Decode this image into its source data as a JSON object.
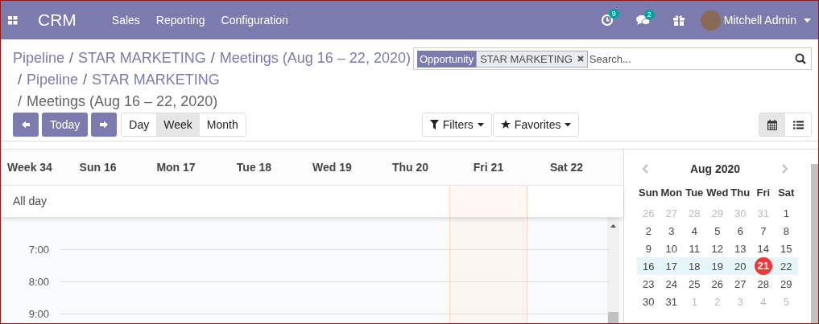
{
  "navbar": {
    "brand": "CRM",
    "menu": [
      "Sales",
      "Reporting",
      "Configuration"
    ],
    "activity_count": "9",
    "message_count": "2",
    "user": "Mitchell Admin"
  },
  "breadcrumbs": [
    [
      {
        "label": "Pipeline",
        "kind": "link"
      },
      {
        "label": "/",
        "kind": "separator"
      },
      {
        "label": "STAR MARKETING",
        "kind": "link"
      },
      {
        "label": "/",
        "kind": "separator"
      },
      {
        "label": "Meetings (Aug 16 – 22, 2020)",
        "kind": "link"
      }
    ],
    [
      {
        "label": "/",
        "kind": "separator"
      },
      {
        "label": "Pipeline",
        "kind": "link"
      },
      {
        "label": "/",
        "kind": "separator"
      },
      {
        "label": "STAR MARKETING",
        "kind": "link"
      }
    ],
    [
      {
        "label": "/",
        "kind": "separator"
      },
      {
        "label": "Meetings (Aug 16 – 22, 2020)",
        "kind": "current"
      }
    ]
  ],
  "search": {
    "facet_label": "Opportunity",
    "facet_value": "STAR MARKETING",
    "placeholder": "Search..."
  },
  "toolbar": {
    "today": "Today",
    "scales": [
      {
        "label": "Day",
        "selected": false
      },
      {
        "label": "Week",
        "selected": true
      },
      {
        "label": "Month",
        "selected": false
      }
    ],
    "filters": "Filters",
    "favorites": "Favorites",
    "views": [
      {
        "kind": "calendar",
        "selected": true
      },
      {
        "kind": "list",
        "selected": false
      }
    ]
  },
  "calendar": {
    "week_label": "Week 34",
    "all_day": "All day",
    "days": [
      {
        "label": "Sun 16",
        "today": false
      },
      {
        "label": "Mon 17",
        "today": false
      },
      {
        "label": "Tue 18",
        "today": false
      },
      {
        "label": "Wed 19",
        "today": false
      },
      {
        "label": "Thu 20",
        "today": false
      },
      {
        "label": "Fri 21",
        "today": true
      },
      {
        "label": "Sat 22",
        "today": false
      }
    ],
    "hours": [
      "7:00",
      "8:00",
      "9:00"
    ]
  },
  "mini_calendar": {
    "title": "Aug 2020",
    "weekdays": [
      "Sun",
      "Mon",
      "Tue",
      "Wed",
      "Thu",
      "Fri",
      "Sat"
    ],
    "weeks": [
      {
        "current": false,
        "days": [
          {
            "label": "26",
            "muted": true,
            "today": false
          },
          {
            "label": "27",
            "muted": true,
            "today": false
          },
          {
            "label": "28",
            "muted": true,
            "today": false
          },
          {
            "label": "29",
            "muted": true,
            "today": false
          },
          {
            "label": "30",
            "muted": true,
            "today": false
          },
          {
            "label": "31",
            "muted": true,
            "today": false
          },
          {
            "label": "1",
            "muted": false,
            "today": false
          }
        ]
      },
      {
        "current": false,
        "days": [
          {
            "label": "2",
            "muted": false,
            "today": false
          },
          {
            "label": "3",
            "muted": false,
            "today": false
          },
          {
            "label": "4",
            "muted": false,
            "today": false
          },
          {
            "label": "5",
            "muted": false,
            "today": false
          },
          {
            "label": "6",
            "muted": false,
            "today": false
          },
          {
            "label": "7",
            "muted": false,
            "today": false
          },
          {
            "label": "8",
            "muted": false,
            "today": false
          }
        ]
      },
      {
        "current": false,
        "days": [
          {
            "label": "9",
            "muted": false,
            "today": false
          },
          {
            "label": "10",
            "muted": false,
            "today": false
          },
          {
            "label": "11",
            "muted": false,
            "today": false
          },
          {
            "label": "12",
            "muted": false,
            "today": false
          },
          {
            "label": "13",
            "muted": false,
            "today": false
          },
          {
            "label": "14",
            "muted": false,
            "today": false
          },
          {
            "label": "15",
            "muted": false,
            "today": false
          }
        ]
      },
      {
        "current": true,
        "days": [
          {
            "label": "16",
            "muted": false,
            "today": false
          },
          {
            "label": "17",
            "muted": false,
            "today": false
          },
          {
            "label": "18",
            "muted": false,
            "today": false
          },
          {
            "label": "19",
            "muted": false,
            "today": false
          },
          {
            "label": "20",
            "muted": false,
            "today": false
          },
          {
            "label": "21",
            "muted": false,
            "today": true
          },
          {
            "label": "22",
            "muted": false,
            "today": false
          }
        ]
      },
      {
        "current": false,
        "days": [
          {
            "label": "23",
            "muted": false,
            "today": false
          },
          {
            "label": "24",
            "muted": false,
            "today": false
          },
          {
            "label": "25",
            "muted": false,
            "today": false
          },
          {
            "label": "26",
            "muted": false,
            "today": false
          },
          {
            "label": "27",
            "muted": false,
            "today": false
          },
          {
            "label": "28",
            "muted": false,
            "today": false
          },
          {
            "label": "29",
            "muted": false,
            "today": false
          }
        ]
      },
      {
        "current": false,
        "days": [
          {
            "label": "30",
            "muted": false,
            "today": false
          },
          {
            "label": "31",
            "muted": false,
            "today": false
          },
          {
            "label": "1",
            "muted": true,
            "today": false
          },
          {
            "label": "2",
            "muted": true,
            "today": false
          },
          {
            "label": "3",
            "muted": true,
            "today": false
          },
          {
            "label": "4",
            "muted": true,
            "today": false
          },
          {
            "label": "5",
            "muted": true,
            "today": false
          }
        ]
      }
    ]
  }
}
